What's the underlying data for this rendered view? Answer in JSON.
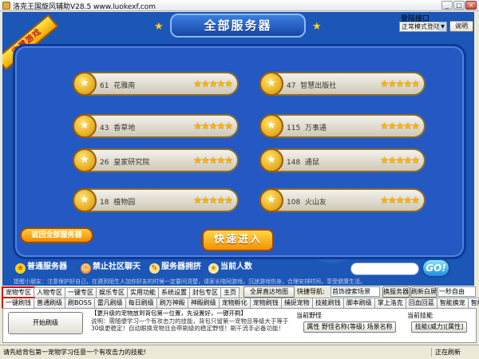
{
  "window": {
    "title": "洛克王国旋风辅助V28.5 www.luokexf.com",
    "minimize": "_",
    "maximize": "□",
    "close": "×"
  },
  "login": {
    "label": "登陆接口",
    "mode": "正常模式登陆",
    "explain_button": "说明"
  },
  "game": {
    "favorite_ribbon": "收藏游戏",
    "header_title": "全部服务器",
    "servers": [
      {
        "number": "61",
        "name": "花雅南",
        "stars": 5
      },
      {
        "number": "47",
        "name": "智慧出版社",
        "stars": 5
      },
      {
        "number": "43",
        "name": "香草地",
        "stars": 5
      },
      {
        "number": "115",
        "name": "万事通",
        "stars": 5
      },
      {
        "number": "26",
        "name": "皇家研究院",
        "stars": 5
      },
      {
        "number": "148",
        "name": "通鼠",
        "stars": 5
      },
      {
        "number": "18",
        "name": "植物园",
        "stars": 5
      },
      {
        "number": "108",
        "name": "火山友",
        "stars": 5
      }
    ],
    "back_button": "返回全部服务器",
    "quick_enter_button": "快速进入",
    "legend": {
      "normal": "普通服务器",
      "no_chat": "禁止社区聊天",
      "crowded": "服务器拥挤",
      "current": "当前人数"
    },
    "go_button": "GO!",
    "marquee": "提醒小朋友：注意保护好自己，在遇到陌生人加你好友的时候一定要问清楚，请家长陪同游戏，沉迷游戏伤身，合理安排时间，享受健康生活。"
  },
  "tabs_row1": [
    "宠物专区",
    "人物专区",
    "一键专区",
    "娱乐专区",
    "实用功能",
    "系统设置",
    "封包专区",
    "主页"
  ],
  "tabs_row1_extra": {
    "full_screen_button": "全屏直达地图",
    "nav_label": "快捷导航:",
    "nav_value": "首饰搜索场景",
    "switch_server_button": "换服务器",
    "refresh_button": "刷新白屏",
    "oneclick_select": "一秒自由"
  },
  "tabs_row2": [
    "一键刷钱",
    "普通刷级",
    "刷BOSS",
    "雷凡刷级",
    "每日刷级",
    "刷万神殿",
    "神殿刷级",
    "宠物孵化",
    "宠物刷钱",
    "捕捉宠物",
    "技能刷钱",
    "脚本刷级",
    "掌上洛克",
    "回血回蓝",
    "智能换宠",
    "智能补血"
  ],
  "lower": {
    "start_button": "开始刷级",
    "description_line1": "【更升级的宠物放到背包第一位置，先设置好，一键开刷】",
    "description_line2": "说明：需随便学习一个有攻击力的技能，背包只留第一宠物且等级大于等于30级更稳定！自动跟换宠物且会带刷级的稳定野怪！刷千流手必备功能！",
    "current_wild_label": "当前野怪",
    "wild_value": "属性  野怪名称(等级)  场景名称",
    "current_skill_label": "当前技能",
    "skill_value": "技能(威力)[属性]"
  },
  "status": {
    "left": "请先给背包第一宠物学习任意一个有攻击力的技能!",
    "right": "正在刷新"
  }
}
